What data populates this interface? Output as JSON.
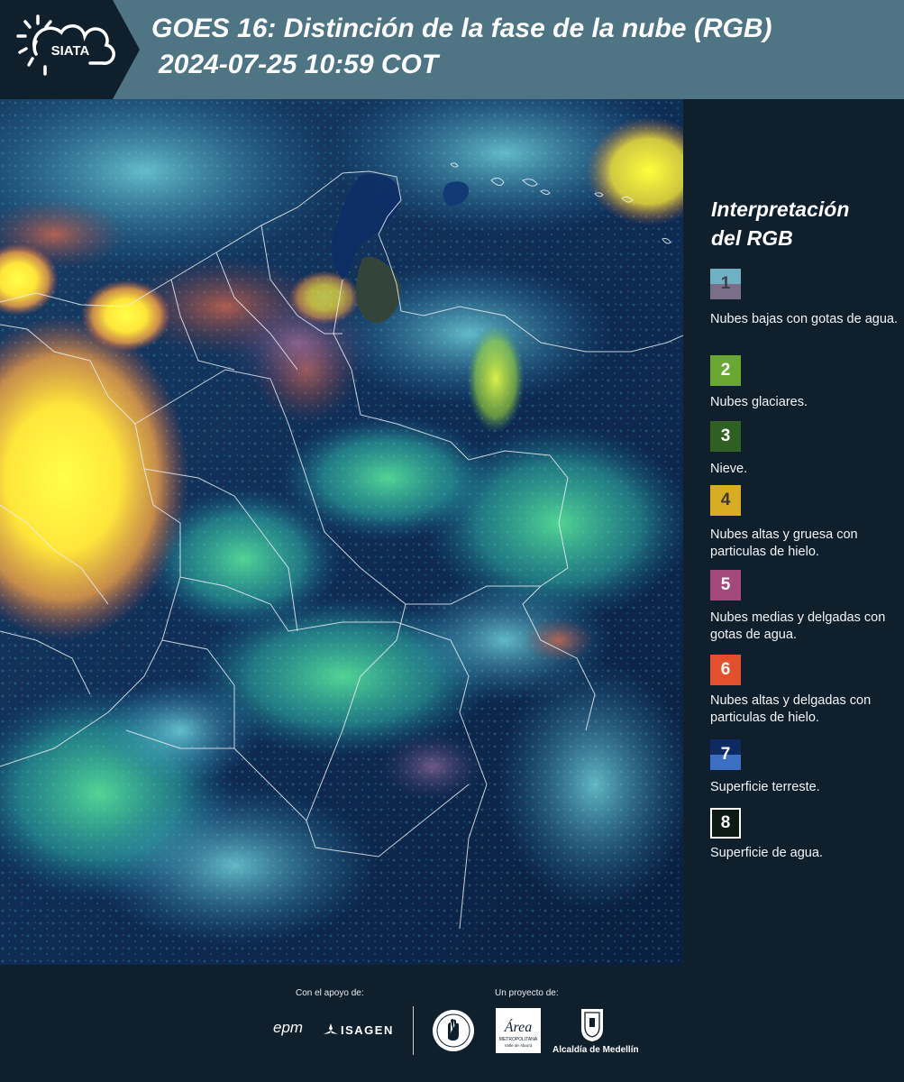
{
  "header": {
    "logo_text": "SIATA",
    "title": "GOES 16: Distinción de la fase de la nube (RGB)",
    "subtitle": "2024-07-25 10:59 COT"
  },
  "legend": {
    "title_line1": "Interpretación",
    "title_line2": "del RGB",
    "items": [
      {
        "number": "1",
        "label": "Nubes bajas con gotas de agua.",
        "color_top": "#6fb0c3",
        "color_bottom": "#7a6e88"
      },
      {
        "number": "2",
        "label": "Nubes glaciares.",
        "color": "#6aa632"
      },
      {
        "number": "3",
        "label": "Nieve.",
        "color": "#2f5f23"
      },
      {
        "number": "4",
        "label": "Nubes altas y gruesa con particulas de hielo.",
        "color": "#d9ac22"
      },
      {
        "number": "5",
        "label": "Nubes medias y delgadas con gotas de agua.",
        "color": "#a3497b"
      },
      {
        "number": "6",
        "label": "Nubes altas y delgadas con particulas de hielo.",
        "color": "#e3502c"
      },
      {
        "number": "7",
        "label": "Superficie terreste.",
        "color_top": "#0f2a63",
        "color_bottom": "#3d6ec6"
      },
      {
        "number": "8",
        "label": "Superficie de agua.",
        "color": "#0d1a14"
      }
    ]
  },
  "footer": {
    "support_label": "Con el apoyo de:",
    "project_label": "Un proyecto de:",
    "sponsors": [
      "epm",
      "ISAGEN"
    ],
    "area_logo_text": "Área",
    "area_subtext": "METROPOLITANA",
    "area_subtext2": "Valle de Aburrá",
    "alcaldia_label": "Alcaldía de Medellín"
  }
}
